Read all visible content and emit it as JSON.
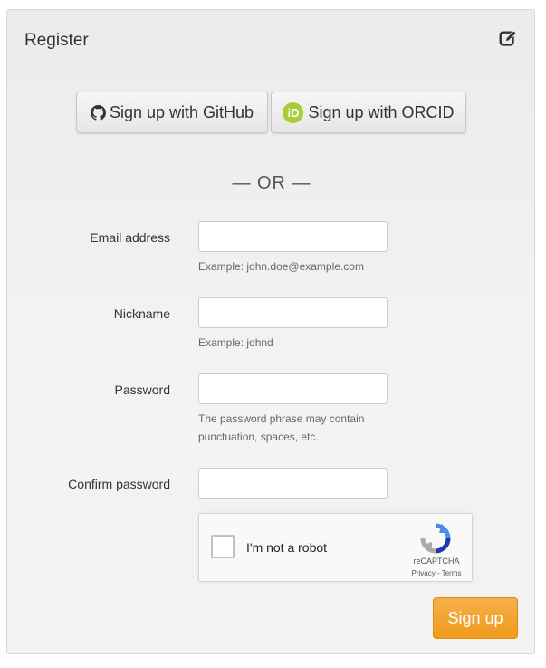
{
  "panel": {
    "title": "Register"
  },
  "oauth": {
    "github_label": "Sign up with GitHub",
    "orcid_label": "Sign up with ORCID",
    "orcid_icon_text": "iD",
    "orcid_color": "#a6ce39"
  },
  "divider": {
    "text": "— OR —"
  },
  "form": {
    "email": {
      "label": "Email address",
      "value": "",
      "help": "Example: john.doe@example.com"
    },
    "nickname": {
      "label": "Nickname",
      "value": "",
      "help": "Example: johnd"
    },
    "password": {
      "label": "Password",
      "value": "",
      "help": "The password phrase may contain punctuation, spaces, etc."
    },
    "confirm_password": {
      "label": "Confirm password",
      "value": ""
    }
  },
  "captcha": {
    "checkbox_label": "I'm not a robot",
    "brand": "reCAPTCHA",
    "links": "Privacy - Terms"
  },
  "actions": {
    "signup_label": "Sign up",
    "accent_color": "#f0a030"
  },
  "icons": {
    "edit": "edit-icon",
    "github": "github-icon",
    "orcid": "orcid-icon",
    "recaptcha": "recaptcha-icon"
  }
}
